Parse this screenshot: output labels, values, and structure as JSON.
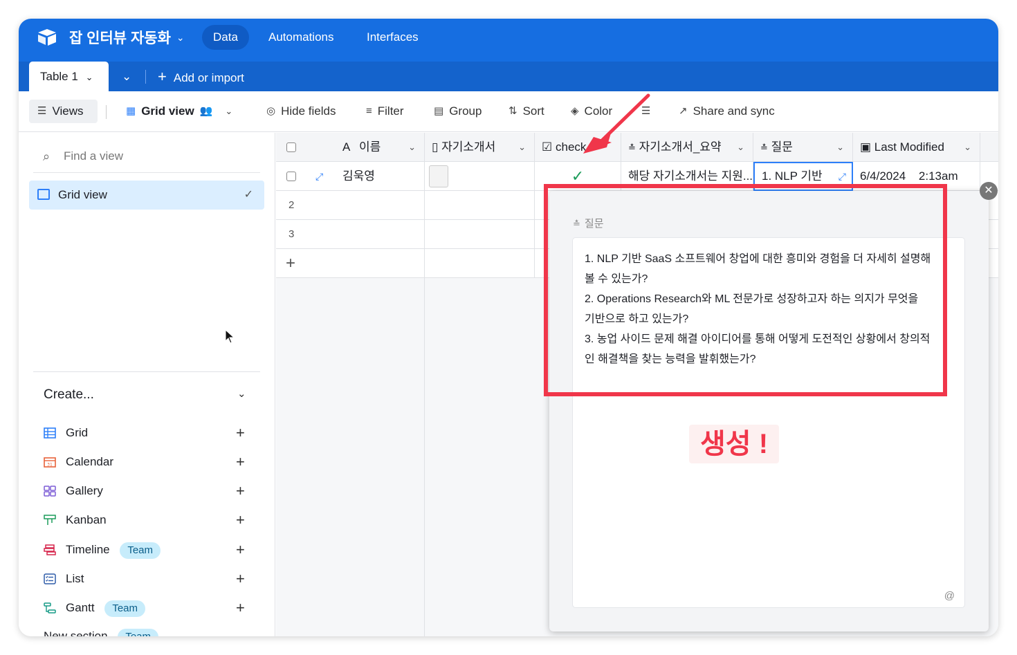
{
  "app": {
    "base_title": "잡 인터뷰 자동화",
    "nav": [
      "Data",
      "Automations",
      "Interfaces"
    ],
    "table_tab": "Table 1",
    "add_import": "Add or import"
  },
  "toolbar": {
    "views": "Views",
    "grid_view": "Grid view",
    "hide_fields": "Hide fields",
    "filter": "Filter",
    "group": "Group",
    "sort": "Sort",
    "color": "Color",
    "share": "Share and sync"
  },
  "sidebar": {
    "find_placeholder": "Find a view",
    "active_view": "Grid view",
    "create_title": "Create...",
    "items": [
      {
        "label": "Grid",
        "badge": ""
      },
      {
        "label": "Calendar",
        "badge": ""
      },
      {
        "label": "Gallery",
        "badge": ""
      },
      {
        "label": "Kanban",
        "badge": ""
      },
      {
        "label": "Timeline",
        "badge": "Team"
      },
      {
        "label": "List",
        "badge": ""
      },
      {
        "label": "Gantt",
        "badge": "Team"
      }
    ],
    "partial_item": "New section",
    "partial_badge": "Team"
  },
  "grid": {
    "columns": [
      "이름",
      "자기소개서",
      "check",
      "자기소개서_요약",
      "질문",
      "Last Modified"
    ],
    "row1": {
      "name": "김욱영",
      "summary": "해당 자기소개서는 지원...",
      "question": "1. NLP 기반",
      "date": "6/4/2024",
      "time": "2:13am"
    },
    "row_numbers": [
      "2",
      "3"
    ]
  },
  "popup": {
    "field_label": "질문",
    "lines": [
      "1. NLP 기반 SaaS 소프트웨어 창업에 대한 흥미와 경험을 더 자세히 설명해",
      "볼 수 있는가?",
      "2. Operations Research와 ML 전문가로 성장하고자 하는 의지가 무엇을",
      "기반으로 하고 있는가?",
      "3. 농업 사이드 문제 해결 아이디어를 통해 어떻게 도전적인 상황에서 창의적",
      "인 해결책을 찾는 능력을 발휘했는가?"
    ],
    "at_symbol": "@"
  },
  "annotation": {
    "label": "생성 !",
    "color": "#f0364a"
  },
  "colors": {
    "topbar": "#166ee1",
    "accent": "#2d7ff9",
    "selected_view": "#dbeeff"
  }
}
